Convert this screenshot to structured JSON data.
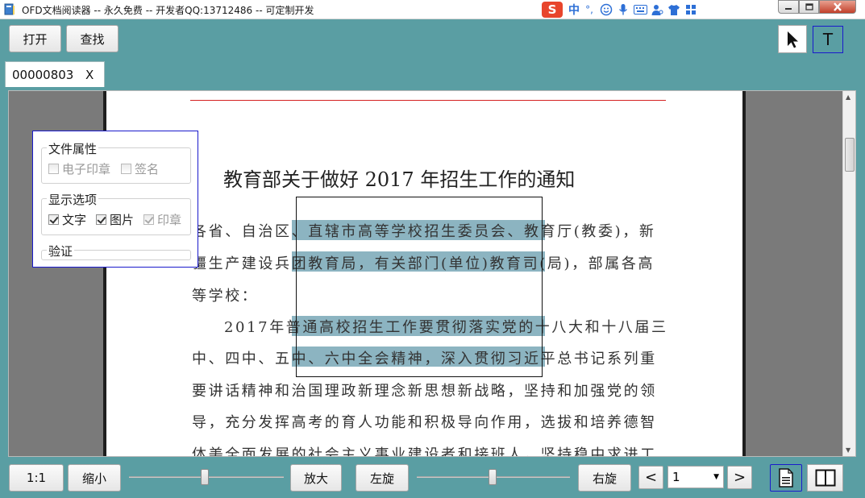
{
  "window": {
    "title": "OFD文档阅读器 -- 永久免费 -- 开发者QQ:13712486 -- 可定制开发",
    "ime_logo": "S",
    "ime_mode": "中",
    "ime_punct": "°,"
  },
  "toolbar": {
    "open_label": "打开",
    "find_label": "查找",
    "select_tool_label": "T"
  },
  "tabs": [
    {
      "label": "00000803",
      "close": "X"
    }
  ],
  "document": {
    "title": "教育部关于做好 2017 年招生工作的通知",
    "lines": [
      "各省、自治区、直辖市高等学校招生委员会、教育厅(教委)，新",
      "疆生产建设兵团教育局，有关部门(单位)教育司(局)，部属各高",
      "等学校：",
      "2017年普通高校招生工作要贯彻落实党的十八大和十八届三",
      "中、四中、五中、六中全会精神，深入贯彻习近平总书记系列重",
      "要讲话精神和治国理政新理念新思想新战略，坚持和加强党的领",
      "导，充分发挥高考的育人功能和积极导向作用，选拔和培养德智",
      "体美全面发展的社会主义事业建设者和接班人，坚持稳中求进工"
    ]
  },
  "props_panel": {
    "file_group": {
      "title": "文件属性",
      "options": [
        {
          "label": "电子印章",
          "checked": false,
          "enabled": false
        },
        {
          "label": "签名",
          "checked": false,
          "enabled": false
        }
      ]
    },
    "display_group": {
      "title": "显示选项",
      "options": [
        {
          "label": "文字",
          "checked": true,
          "enabled": true
        },
        {
          "label": "图片",
          "checked": true,
          "enabled": true
        },
        {
          "label": "印章",
          "checked": true,
          "enabled": false
        }
      ]
    },
    "verify_group": {
      "title": "验证"
    }
  },
  "bottombar": {
    "actual_size_label": "1:1",
    "zoom_out_label": "缩小",
    "zoom_in_label": "放大",
    "rotate_left_label": "左旋",
    "rotate_right_label": "右旋",
    "prev_page": "<",
    "next_page": ">",
    "page_select_value": "1"
  },
  "colors": {
    "app_background": "#5a9ea3",
    "selection_highlight": "#5b94a6",
    "panel_border": "#1a1acc",
    "header_rule": "#d42020"
  }
}
